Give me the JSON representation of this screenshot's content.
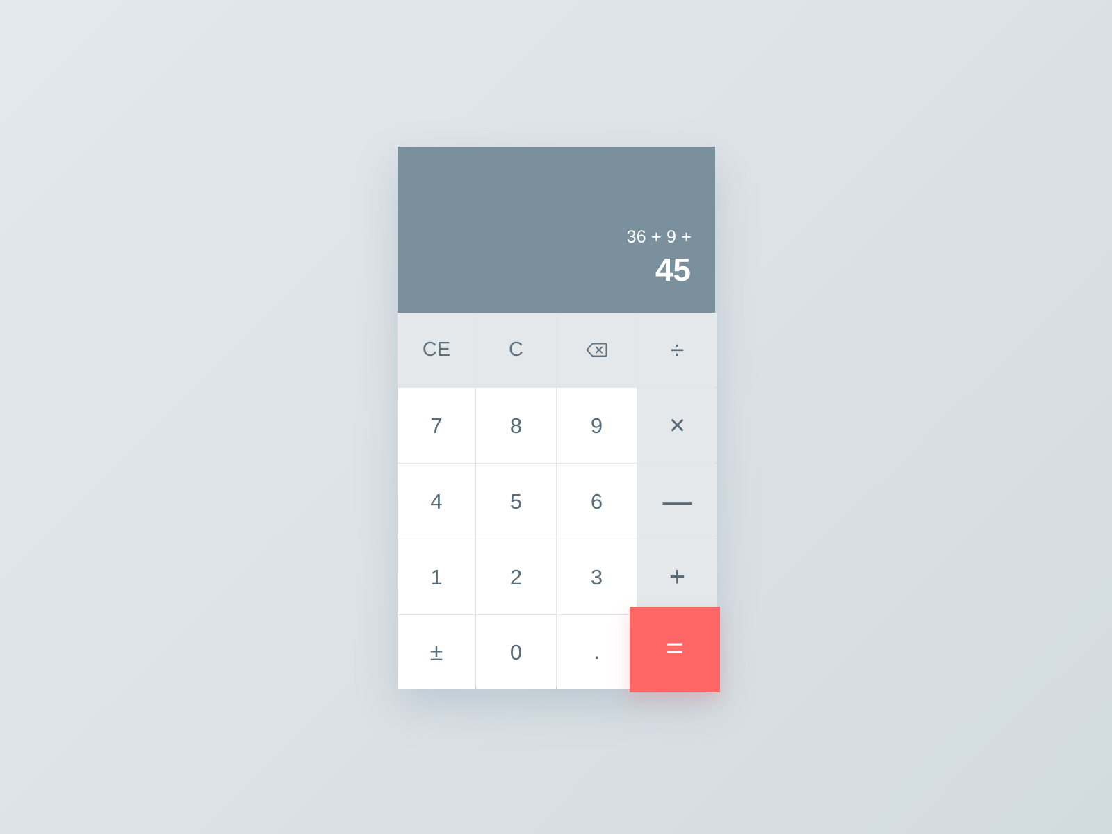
{
  "display": {
    "expression": "36 + 9 +",
    "result": "45"
  },
  "keys": {
    "ce": "CE",
    "c": "C",
    "backspace_icon": "backspace-icon",
    "divide": "÷",
    "seven": "7",
    "eight": "8",
    "nine": "9",
    "multiply": "×",
    "four": "4",
    "five": "5",
    "six": "6",
    "minus": "—",
    "one": "1",
    "two": "2",
    "three": "3",
    "plus": "+",
    "plus_minus": "±",
    "zero": "0",
    "decimal": ".",
    "equals": "="
  },
  "colors": {
    "background": "#dfe5e9",
    "display_background": "#7a909c",
    "display_text": "#ffffff",
    "function_key_background": "#e4e8eb",
    "digit_key_background": "#ffffff",
    "key_text": "#5a6d7b",
    "equals_background": "#ff6666",
    "equals_text": "#ffffff"
  }
}
